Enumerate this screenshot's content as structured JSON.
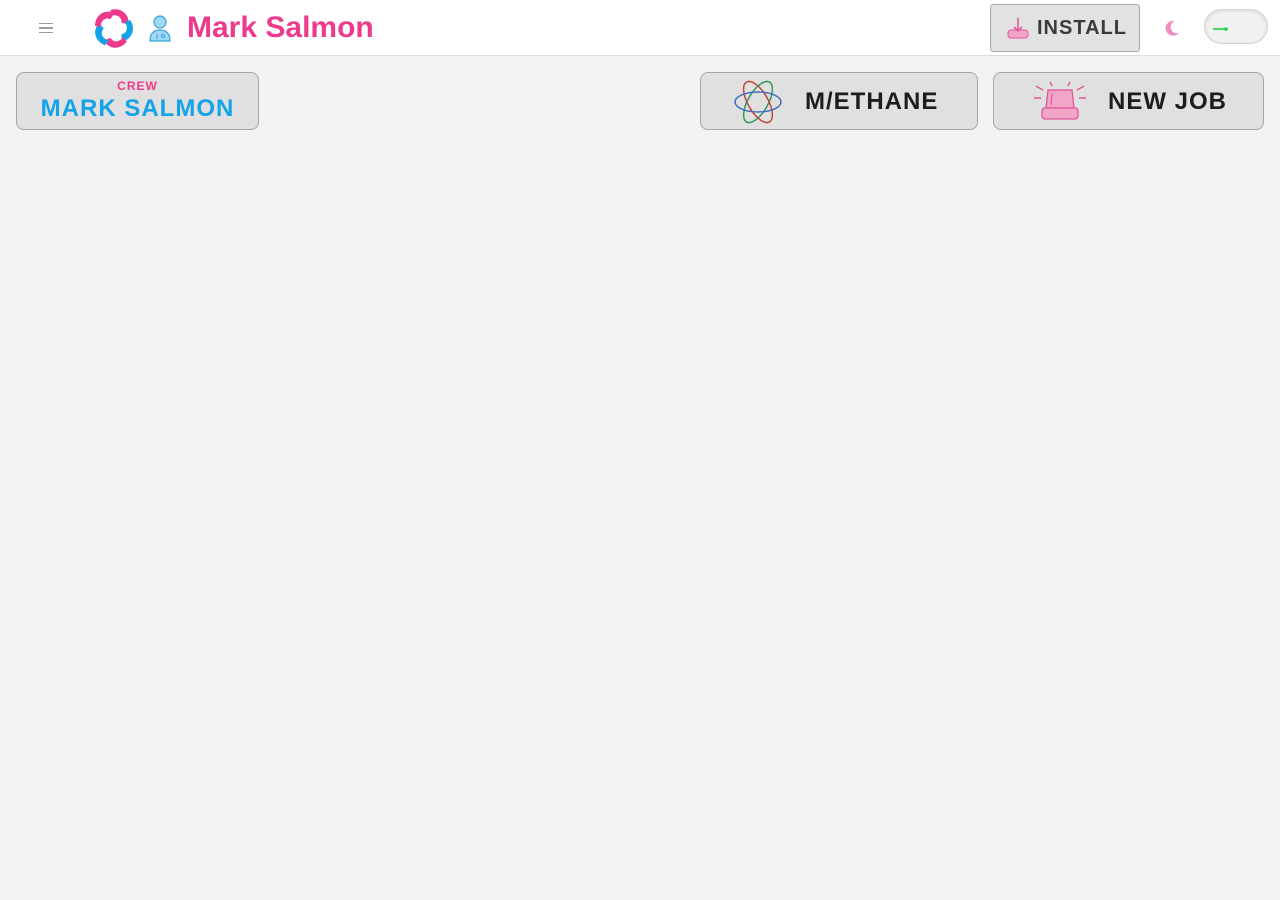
{
  "header": {
    "title": "Mark Salmon",
    "install_label": "INSTALL",
    "menu_icon": "hamburger-menu-icon",
    "logo_icon": "swirl-logo-icon",
    "user_icon": "user-icon",
    "install_icon": "download-tray-icon",
    "theme_icon": "moon-icon",
    "toggle": "dark-mode-toggle"
  },
  "crew": {
    "label": "CREW",
    "name": "MARK SALMON"
  },
  "actions": {
    "methane_label": "M/ETHANE",
    "methane_icon": "interlocking-rings-icon",
    "new_job_label": "NEW JOB",
    "new_job_icon": "siren-light-icon"
  },
  "colors": {
    "brand_pink": "#ee3a8c",
    "brand_blue": "#12a3e9",
    "toggle_green": "#22cc44",
    "background": "#f3f3f3"
  }
}
